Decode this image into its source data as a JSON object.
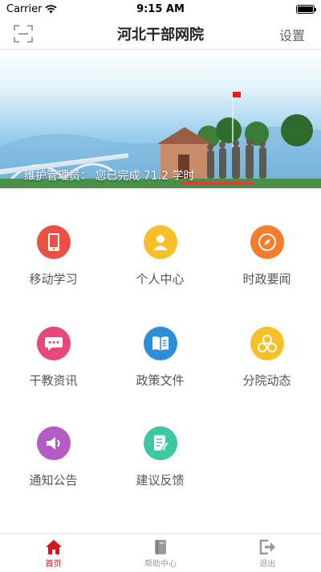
{
  "status_bar": {
    "carrier": "Carrier",
    "time": "9:15 AM"
  },
  "nav": {
    "title": "河北干部网院",
    "settings_label": "设置",
    "scan_icon": "scan-icon"
  },
  "banner": {
    "text_prefix": "维护管理员： 您已完成 ",
    "hours": "71.2",
    "text_suffix": " 学时"
  },
  "grid": {
    "items": [
      {
        "label": "移动学习",
        "icon": "mobile-icon",
        "color": "#ec5045"
      },
      {
        "label": "个人中心",
        "icon": "user-icon",
        "color": "#f6c026"
      },
      {
        "label": "时政要闻",
        "icon": "compass-icon",
        "color": "#f57d2b"
      },
      {
        "label": "干教资讯",
        "icon": "chat-icon",
        "color": "#e8477a"
      },
      {
        "label": "政策文件",
        "icon": "book-icon",
        "color": "#2b8ed7"
      },
      {
        "label": "分院动态",
        "icon": "hexagon-icon",
        "color": "#f6c026"
      },
      {
        "label": "通知公告",
        "icon": "speaker-icon",
        "color": "#b55bc6"
      },
      {
        "label": "建议反馈",
        "icon": "edit-icon",
        "color": "#3dc8a1"
      }
    ]
  },
  "tabs": [
    {
      "label": "首页",
      "icon": "home-icon",
      "active": true,
      "color": "#d5141c"
    },
    {
      "label": "帮助中心",
      "icon": "help-book-icon",
      "active": false,
      "color": "#999999"
    },
    {
      "label": "退出",
      "icon": "logout-icon",
      "active": false,
      "color": "#999999"
    }
  ]
}
